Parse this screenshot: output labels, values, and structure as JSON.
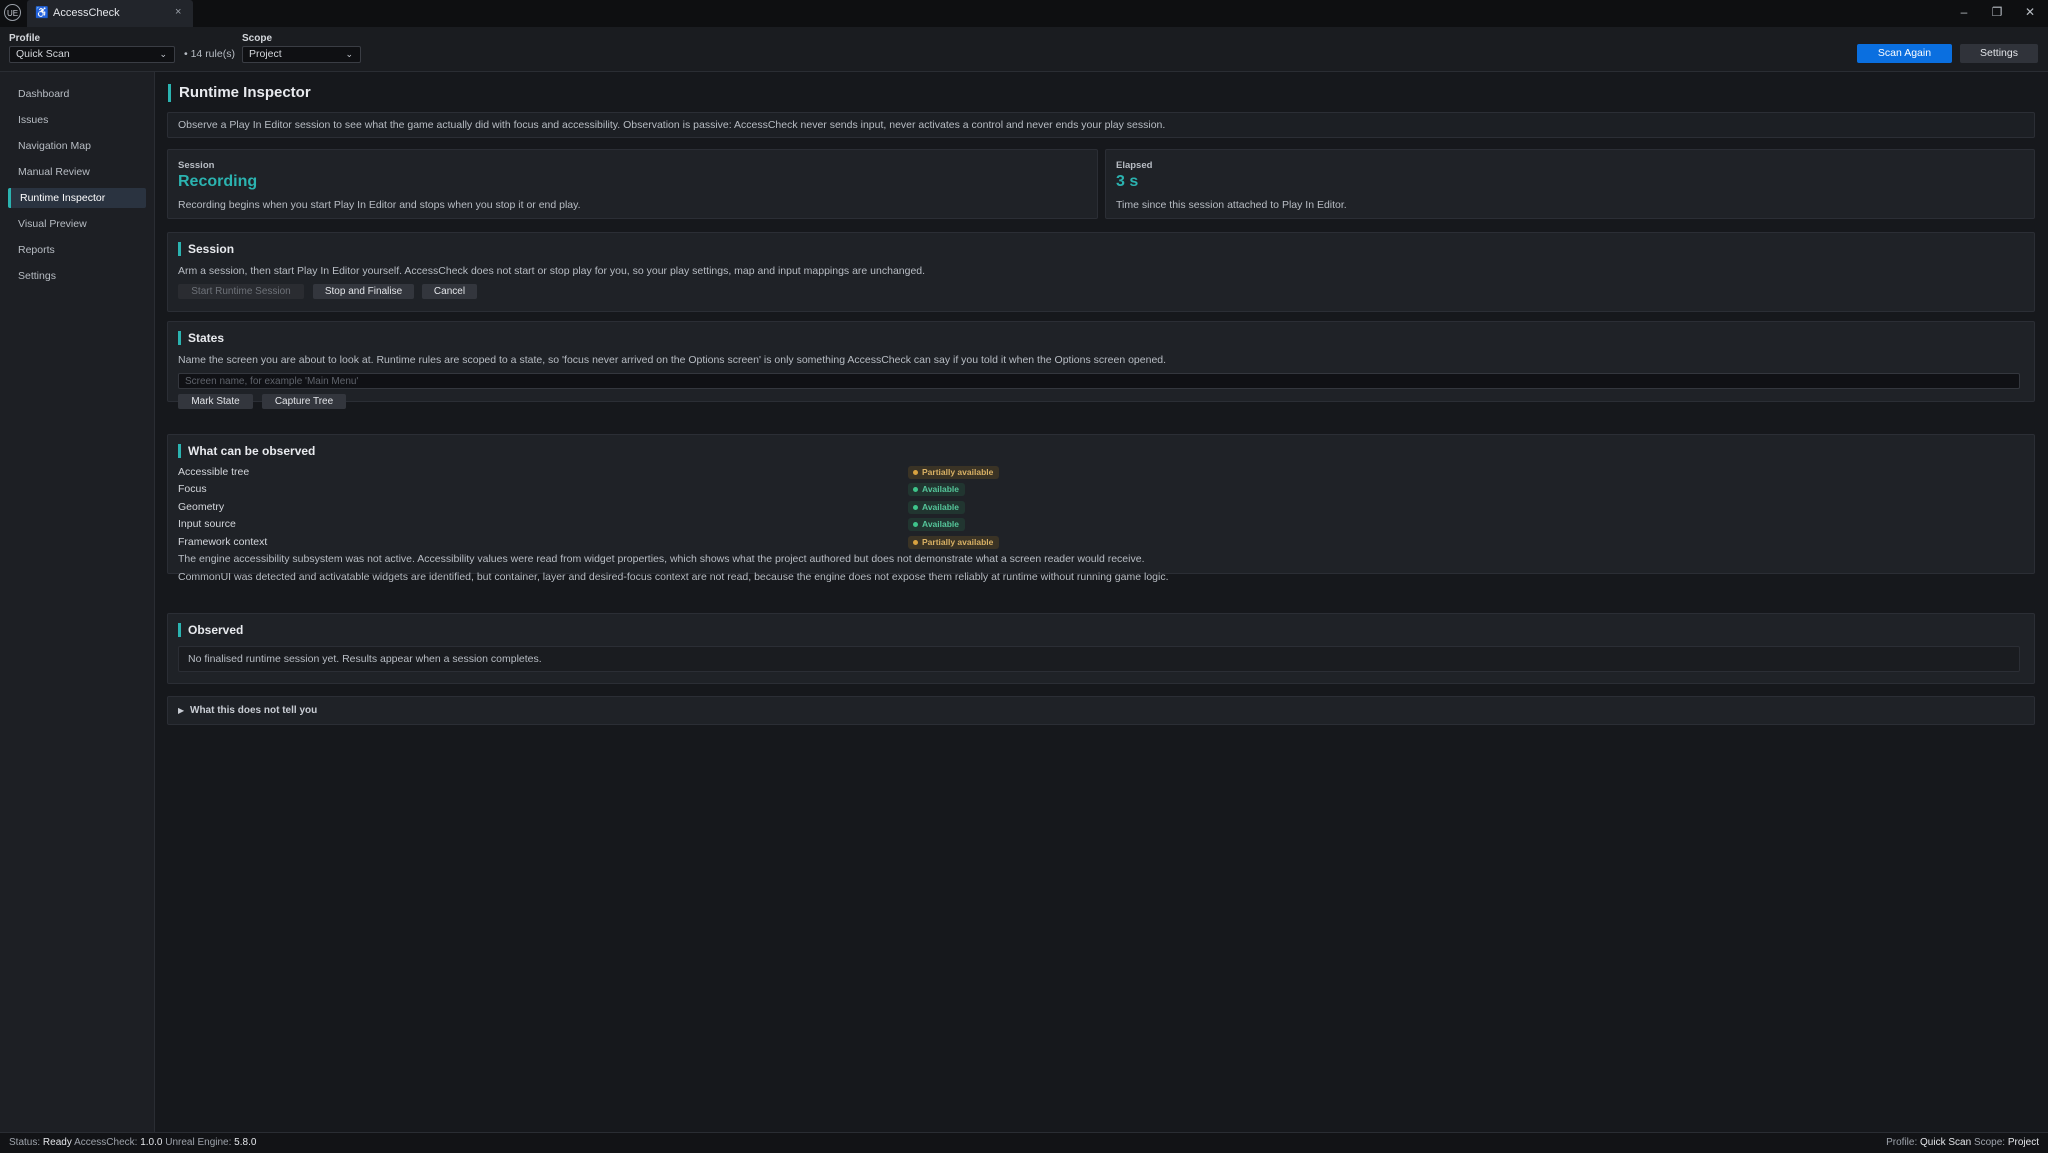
{
  "window": {
    "logo_text": "UE",
    "tab_title": "AccessCheck",
    "tab_close": "×",
    "minimize": "–",
    "restore": "❐",
    "close": "✕"
  },
  "toolbar": {
    "profile_label": "Profile",
    "profile_value": "Quick Scan",
    "rule_count": "• 14 rule(s)",
    "scope_label": "Scope",
    "scope_value": "Project",
    "scan_again": "Scan Again",
    "settings": "Settings"
  },
  "sidebar": {
    "items": [
      {
        "label": "Dashboard"
      },
      {
        "label": "Issues"
      },
      {
        "label": "Navigation Map"
      },
      {
        "label": "Manual Review"
      },
      {
        "label": "Runtime Inspector",
        "active": true
      },
      {
        "label": "Visual Preview"
      },
      {
        "label": "Reports"
      },
      {
        "label": "Settings"
      }
    ]
  },
  "main": {
    "title": "Runtime Inspector",
    "intro": "Observe a Play In Editor session to see what the game actually did with focus and accessibility. Observation is passive: AccessCheck never sends input, never activates a control and never ends your play session.",
    "session_stat": {
      "label": "Session",
      "value": "Recording",
      "desc": "Recording begins when you start Play In Editor and stops when you stop it or end play."
    },
    "elapsed_stat": {
      "label": "Elapsed",
      "value": "3 s",
      "desc": "Time since this session attached to Play In Editor."
    },
    "session": {
      "title": "Session",
      "desc": "Arm a session, then start Play In Editor yourself. AccessCheck does not start or stop play for you, so your play settings, map and input mappings are unchanged.",
      "start_button": "Start Runtime Session",
      "stop_button": "Stop and Finalise",
      "cancel_button": "Cancel"
    },
    "states": {
      "title": "States",
      "desc": "Name the screen you are about to look at. Runtime rules are scoped to a state, so 'focus never arrived on the Options screen' is only something AccessCheck can say if you told it when the Options screen opened.",
      "input_placeholder": "Screen name, for example 'Main Menu'",
      "mark_button": "Mark State",
      "capture_button": "Capture Tree"
    },
    "observable": {
      "title": "What can be observed",
      "rows": [
        {
          "name": "Accessible tree",
          "status": "Partially available"
        },
        {
          "name": "Focus",
          "status": "Available"
        },
        {
          "name": "Geometry",
          "status": "Available"
        },
        {
          "name": "Input source",
          "status": "Available"
        },
        {
          "name": "Framework context",
          "status": "Partially available"
        }
      ],
      "note1": "The engine accessibility subsystem was not active. Accessibility values were read from widget properties, which shows what the project authored but does not demonstrate what a screen reader would receive.",
      "note2": "CommonUI was detected and activatable widgets are identified, but container, layer and desired-focus context are not read, because the engine does not expose them reliably at runtime without running game logic."
    },
    "observed": {
      "title": "Observed",
      "empty": "No finalised runtime session yet. Results appear when a session completes."
    },
    "disclosure": {
      "arrow": "▶",
      "label": "What this does not tell you"
    }
  },
  "statusbar": {
    "status_label": "Status:",
    "status_value": "Ready",
    "app_label": "AccessCheck:",
    "app_version": "1.0.0",
    "engine_label": "Unreal Engine:",
    "engine_version": "5.8.0",
    "profile_label": "Profile:",
    "profile_value": "Quick Scan",
    "scope_label": "Scope:",
    "scope_value": "Project"
  },
  "colors": {
    "accent": "#2bb3b0",
    "primary_button": "#0a6fe0",
    "partial": "#d8a240",
    "available": "#3ec48a"
  }
}
